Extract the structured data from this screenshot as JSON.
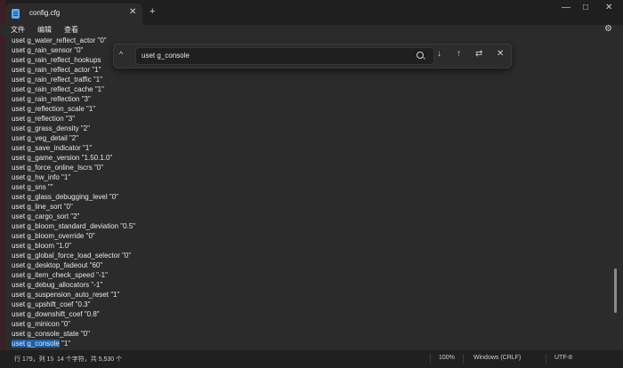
{
  "window": {
    "tab_title": "config.cfg",
    "tab_close": "✕",
    "new_tab": "+",
    "minimize": "—",
    "maximize": "□",
    "close": "✕"
  },
  "menu": {
    "items": [
      "文件",
      "编辑",
      "查看"
    ],
    "settings_icon": "⚙"
  },
  "find": {
    "toggle": "^",
    "query": "uset g_console",
    "prev": "↓",
    "next": "↑",
    "replace_toggle": "⇄",
    "close": "✕"
  },
  "editor": {
    "lines": [
      "uset g_water_reflect_actor \"0\"",
      "uset g_rain_sensor \"0\"",
      "uset g_rain_reflect_hookups",
      "uset g_rain_reflect_actor \"1\"",
      "uset g_rain_reflect_traffic \"1\"",
      "uset g_rain_reflect_cache \"1\"",
      "uset g_rain_reflection \"3\"",
      "uset g_reflection_scale \"1\"",
      "uset g_reflection \"3\"",
      "uset g_grass_density \"2\"",
      "uset g_veg_detail \"2\"",
      "uset g_save_indicator \"1\"",
      "uset g_game_version \"1.50.1.0\"",
      "uset g_force_online_lscrs \"0\"",
      "uset g_hw_info \"1\"",
      "uset g_sns \"\"",
      "uset g_glass_debugging_level \"0\"",
      "uset g_line_sort \"0\"",
      "uset g_cargo_sort \"2\"",
      "uset g_bloom_standard_deviation \"0.5\"",
      "uset g_bloom_override \"0\"",
      "uset g_bloom \"1.0\"",
      "uset g_global_force_load_selector \"0\"",
      "uset g_desktop_fadeout \"60\"",
      "uset g_item_check_speed \"-1\"",
      "uset g_debug_allocators \"-1\"",
      "uset g_suspension_auto_reset \"1\"",
      "uset g_upshift_coef \"0.3\"",
      "uset g_downshift_coef \"0.8\"",
      "uset g_minicon \"0\"",
      "uset g_console_state \"0\""
    ],
    "last_line_selected": "uset g_console",
    "last_line_rest": " \"1\""
  },
  "status": {
    "position": "行 179，列 15",
    "selection": "14 个字符，共 5,530 个",
    "zoom": "100%",
    "line_ending": "Windows (CRLF)",
    "encoding": "UTF-8"
  },
  "colors": {
    "selection": "#1f5fa6",
    "background": "#2b2b2b",
    "titlebar": "#1f1f1f"
  }
}
